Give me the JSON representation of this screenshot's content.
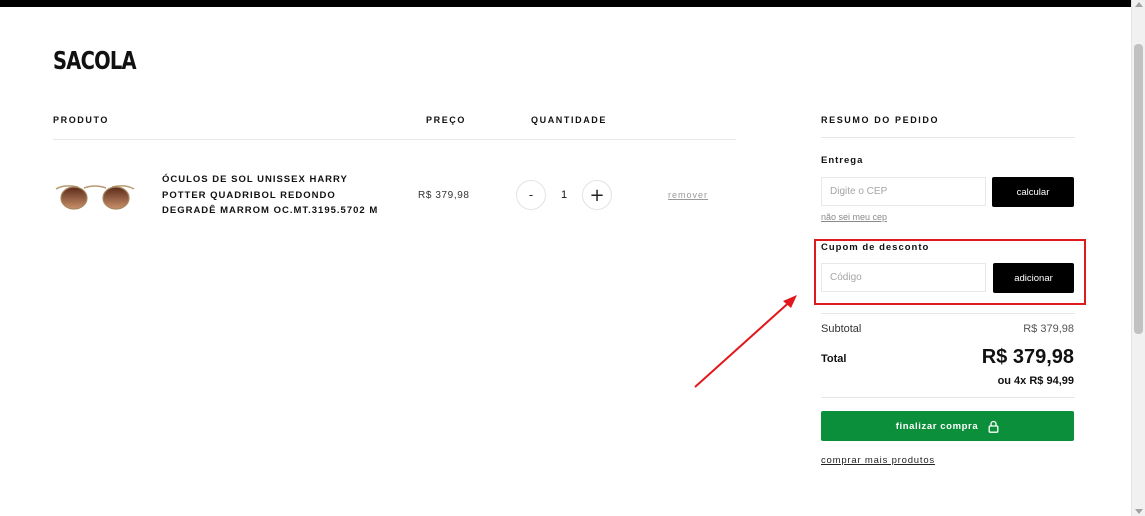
{
  "page": {
    "title": "SACOLA"
  },
  "columns": {
    "produto": "PRODUTO",
    "preco": "PREÇO",
    "quantidade": "QUANTIDADE",
    "resumo": "RESUMO DO PEDIDO"
  },
  "cart_item": {
    "name": "ÓCULOS DE SOL UNISSEX HARRY POTTER QUADRIBOL REDONDO DEGRADÊ MARROM OC.MT.3195.5702 M",
    "price": "R$ 379,98",
    "quantity": "1",
    "minus_label": "-",
    "plus_label": "+",
    "remove_label": "remover"
  },
  "summary": {
    "entrega_label": "Entrega",
    "cep_placeholder": "Digite o CEP",
    "calcular_label": "calcular",
    "nao_sei_cep": "não sei meu cep",
    "cupom_label": "Cupom de desconto",
    "cupom_placeholder": "Código",
    "adicionar_label": "adicionar",
    "subtotal_label": "Subtotal",
    "subtotal_value": "R$ 379,98",
    "total_label": "Total",
    "total_value": "R$ 379,98",
    "installments": "ou 4x R$ 94,99",
    "finalizar_label": "finalizar compra",
    "comprar_mais": "comprar mais produtos"
  },
  "icons": {
    "lock": "lock-icon",
    "sunglasses": "sunglasses-image"
  },
  "colors": {
    "accent_green": "#0b8f3a",
    "highlight_red": "#e0191e",
    "button_black": "#000000"
  }
}
